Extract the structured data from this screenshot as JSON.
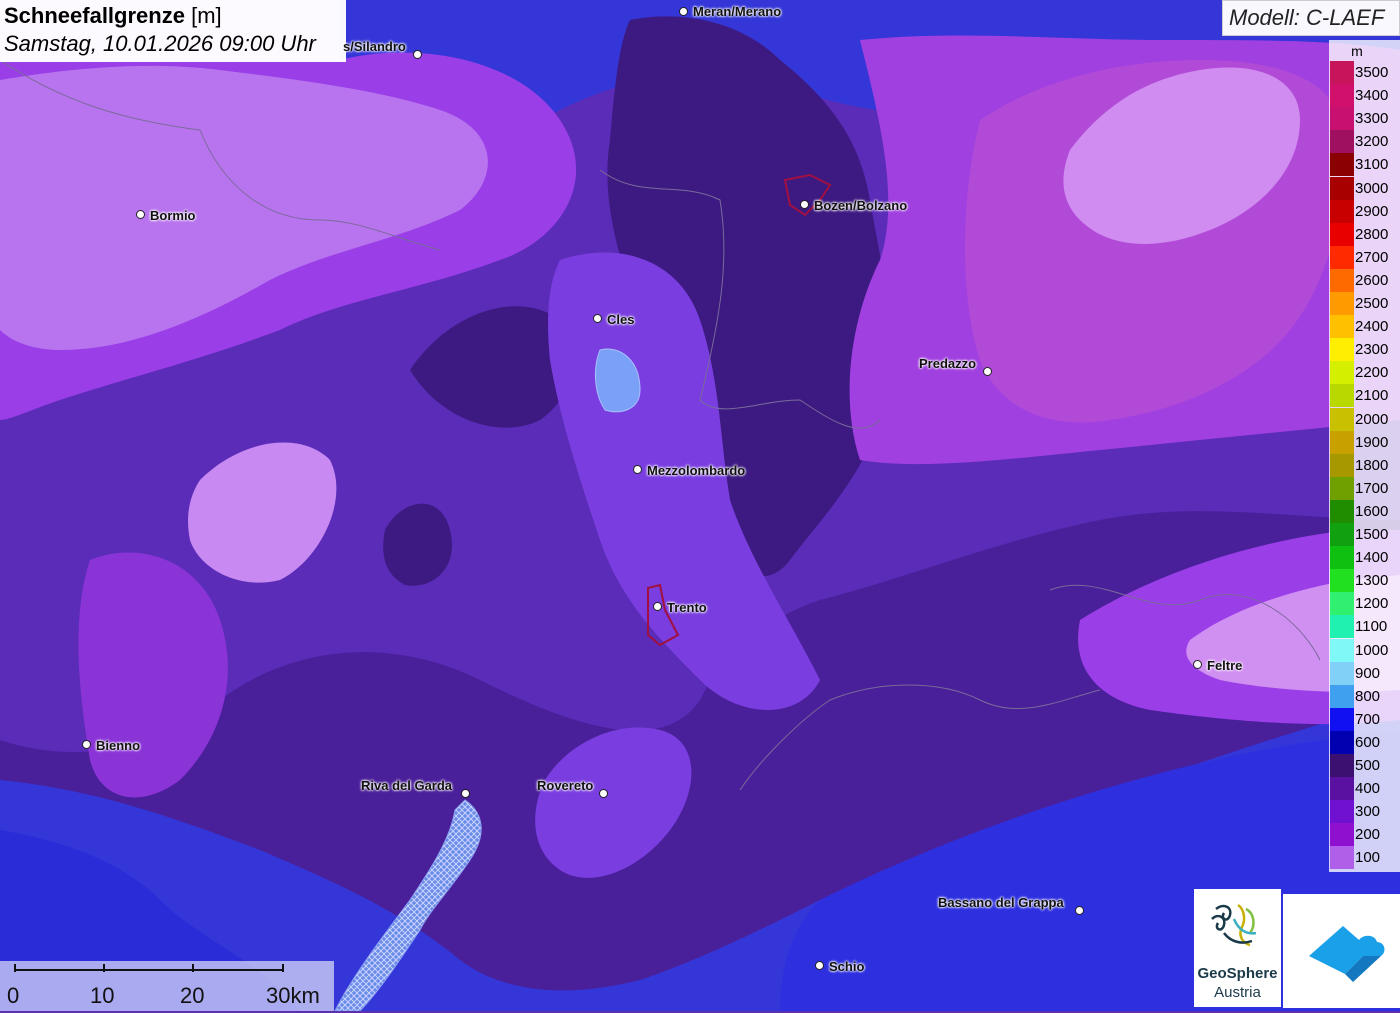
{
  "title": {
    "name": "Schneefallgrenze",
    "unit": "[m]",
    "datetime": "Samstag, 10.01.2026 09:00 Uhr"
  },
  "model": "Modell: C-LAEF",
  "legend": {
    "unit": "m",
    "entries": [
      {
        "label": "3500",
        "color": "#c8145a"
      },
      {
        "label": "3400",
        "color": "#d0106a"
      },
      {
        "label": "3300",
        "color": "#c81070"
      },
      {
        "label": "3200",
        "color": "#a01060"
      },
      {
        "label": "3100",
        "color": "#8b0000"
      },
      {
        "label": "3000",
        "color": "#a80000"
      },
      {
        "label": "2900",
        "color": "#c80000"
      },
      {
        "label": "2800",
        "color": "#e80000"
      },
      {
        "label": "2700",
        "color": "#ff2a00"
      },
      {
        "label": "2600",
        "color": "#ff6a00"
      },
      {
        "label": "2500",
        "color": "#ff9a00"
      },
      {
        "label": "2400",
        "color": "#ffc000"
      },
      {
        "label": "2300",
        "color": "#ffee00"
      },
      {
        "label": "2200",
        "color": "#d4f000"
      },
      {
        "label": "2100",
        "color": "#b8d800"
      },
      {
        "label": "2000",
        "color": "#c8c000"
      },
      {
        "label": "1900",
        "color": "#c8a000"
      },
      {
        "label": "1800",
        "color": "#a89800"
      },
      {
        "label": "1700",
        "color": "#70a000"
      },
      {
        "label": "1600",
        "color": "#208c00"
      },
      {
        "label": "1500",
        "color": "#10a010"
      },
      {
        "label": "1400",
        "color": "#10c010"
      },
      {
        "label": "1300",
        "color": "#20e020"
      },
      {
        "label": "1200",
        "color": "#30f070"
      },
      {
        "label": "1100",
        "color": "#20f0b0"
      },
      {
        "label": "1000",
        "color": "#80f8f8"
      },
      {
        "label": "900",
        "color": "#80d0f8"
      },
      {
        "label": "800",
        "color": "#40a0f0"
      },
      {
        "label": "700",
        "color": "#1010f0"
      },
      {
        "label": "600",
        "color": "#0000b0"
      },
      {
        "label": "500",
        "color": "#3c1070"
      },
      {
        "label": "400",
        "color": "#5a10a0"
      },
      {
        "label": "300",
        "color": "#7010d0"
      },
      {
        "label": "200",
        "color": "#9010d0"
      },
      {
        "label": "100",
        "color": "#b060e8"
      }
    ]
  },
  "cities": [
    {
      "name": "Meran/Merano"
    },
    {
      "name": "Schlanders/Silandro",
      "shown": "s/Silandro"
    },
    {
      "name": "Bormio"
    },
    {
      "name": "Bozen/Bolzano"
    },
    {
      "name": "Cles"
    },
    {
      "name": "Predazzo"
    },
    {
      "name": "Mezzolombardo"
    },
    {
      "name": "Trento"
    },
    {
      "name": "Feltre"
    },
    {
      "name": "Bienno"
    },
    {
      "name": "Riva del Garda"
    },
    {
      "name": "Rovereto"
    },
    {
      "name": "Bassano del Grappa"
    },
    {
      "name": "Schio"
    }
  ],
  "scale": {
    "labels": [
      "0",
      "10",
      "20",
      "30km"
    ]
  },
  "logos": {
    "geosphere_line1": "GeoSphere",
    "geosphere_line2": "Austria"
  }
}
